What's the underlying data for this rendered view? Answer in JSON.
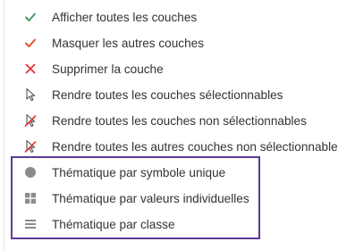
{
  "menu": {
    "items": [
      {
        "label": "Afficher toutes les couches",
        "icon": "check-icon",
        "color": "#4a9a6a"
      },
      {
        "label": "Masquer les autres couches",
        "icon": "check-icon",
        "color": "#e0542c"
      },
      {
        "label": "Supprimer la couche",
        "icon": "close-icon",
        "color": "#e0342c"
      },
      {
        "label": "Rendre toutes les couches sélectionnables",
        "icon": "pointer-icon",
        "color": "#555555"
      },
      {
        "label": "Rendre toutes les couches non sélectionnables",
        "icon": "pointer-disabled-icon",
        "color": "#e0342c"
      },
      {
        "label": "Rendre toutes les autres couches non sélectionnables",
        "icon": "pointer-disabled-icon",
        "color": "#e0342c"
      }
    ],
    "thematic_items": [
      {
        "label": "Thématique par symbole unique",
        "icon": "circle-icon",
        "color": "#8c8c8c"
      },
      {
        "label": "Thématique par valeurs individuelles",
        "icon": "grid-icon",
        "color": "#8c8c8c"
      },
      {
        "label": "Thématique par classe",
        "icon": "list-icon",
        "color": "#8c8c8c"
      }
    ],
    "highlight_color": "#5b3a96"
  }
}
